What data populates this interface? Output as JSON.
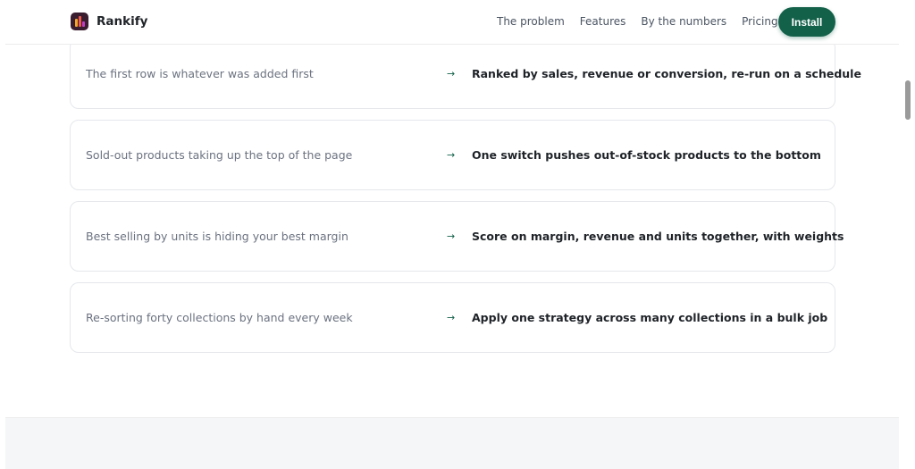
{
  "brand": {
    "name": "Rankify"
  },
  "nav": {
    "links": [
      "The problem",
      "Features",
      "By the numbers",
      "Pricing"
    ],
    "install_label": "Install"
  },
  "comparison": {
    "arrow": "→",
    "rows": [
      {
        "problem": "The first row is whatever was added first",
        "solution": "Ranked by sales, revenue or conversion, re-run on a schedule"
      },
      {
        "problem": "Sold-out products taking up the top of the page",
        "solution": "One switch pushes out-of-stock products to the bottom"
      },
      {
        "problem": "Best selling by units is hiding your best margin",
        "solution": "Score on margin, revenue and units together, with weights"
      },
      {
        "problem": "Re-sorting forty collections by hand every week",
        "solution": "Apply one strategy across many collections in a bulk job"
      }
    ]
  },
  "colors": {
    "accent": "#14614a",
    "logo_bg": "#3a1d2f"
  }
}
